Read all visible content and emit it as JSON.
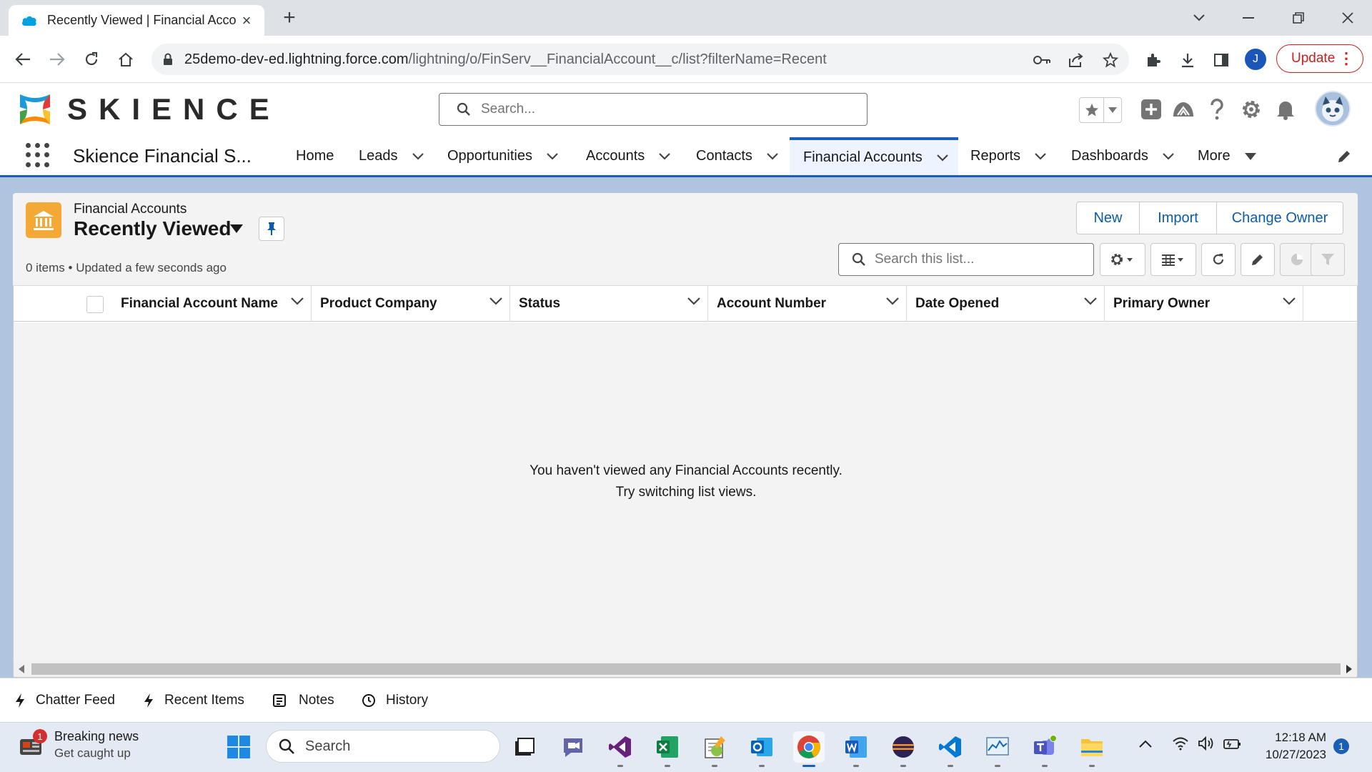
{
  "browser": {
    "tab_title": "Recently Viewed | Financial Acco",
    "url_host": "25demo-dev-ed.lightning.force.com",
    "url_path": "/lightning/o/FinServ__FinancialAccount__c/list?filterName=Recent",
    "profile_initial": "J",
    "update_label": "Update"
  },
  "header": {
    "logo_text": "SKIENCE",
    "search_placeholder": "Search..."
  },
  "nav": {
    "app_name": "Skience Financial S...",
    "items": [
      {
        "label": "Home"
      },
      {
        "label": "Leads"
      },
      {
        "label": "Opportunities"
      },
      {
        "label": "Accounts"
      },
      {
        "label": "Contacts"
      },
      {
        "label": "Financial Accounts",
        "active": true
      },
      {
        "label": "Reports"
      },
      {
        "label": "Dashboards"
      },
      {
        "label": "More"
      }
    ]
  },
  "list": {
    "object_label": "Financial Accounts",
    "view_name": "Recently Viewed",
    "meta": "0 items • Updated a few seconds ago",
    "buttons": [
      "New",
      "Import",
      "Change Owner"
    ],
    "search_placeholder": "Search this list...",
    "columns": [
      "Financial Account Name",
      "Product Company",
      "Status",
      "Account Number",
      "Date Opened",
      "Primary Owner"
    ],
    "rows": [],
    "empty_line1": "You haven't viewed any Financial Accounts recently.",
    "empty_line2": "Try switching list views."
  },
  "utility_bar": {
    "items": [
      "Chatter Feed",
      "Recent Items",
      "Notes",
      "History"
    ]
  },
  "taskbar": {
    "news_title": "Breaking news",
    "news_subtitle": "Get caught up",
    "news_badge": "1",
    "search_placeholder": "Search",
    "time": "12:18 AM",
    "date": "10/27/2023",
    "notification_count": "1"
  },
  "colors": {
    "brand_blue": "#1b5dbb",
    "link_blue": "#0b5cab",
    "object_icon": "#f4a835",
    "page_bg": "#b0c4df"
  }
}
